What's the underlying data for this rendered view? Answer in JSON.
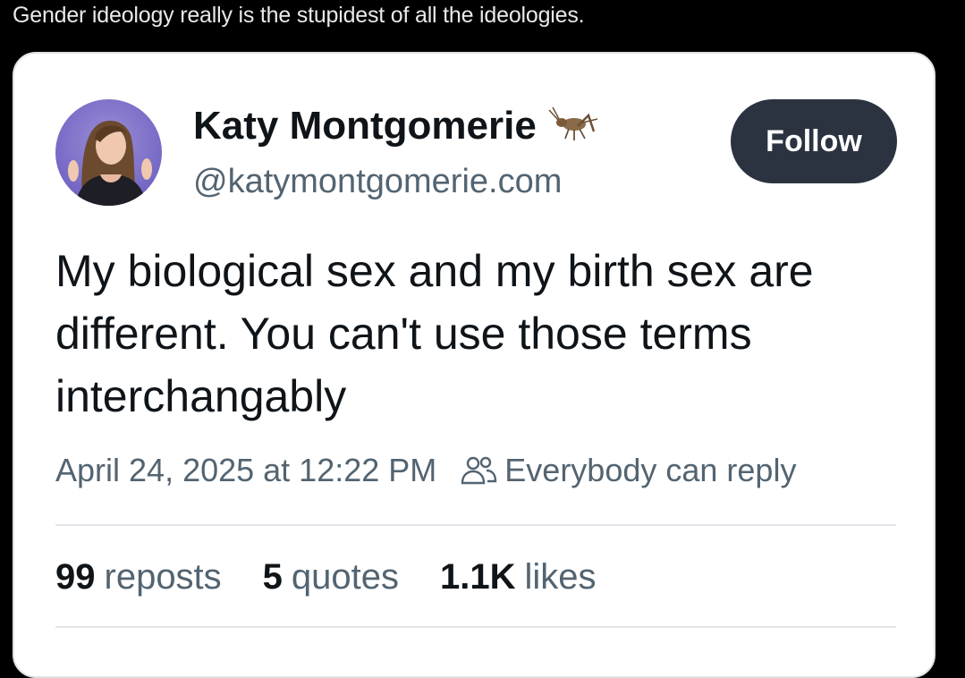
{
  "caption": "Gender ideology really is the stupidest of all the ideologies.",
  "tweet": {
    "author_name": "Katy Montgomerie",
    "author_handle": "@katymontgomerie.com",
    "follow_label": "Follow",
    "text": "My biological sex and my birth sex are different. You can't use those terms interchangably",
    "timestamp": "April 24, 2025 at 12:22 PM",
    "reply_setting": "Everybody can reply",
    "stats": {
      "reposts_count": "99",
      "reposts_label": "reposts",
      "quotes_count": "5",
      "quotes_label": "quotes",
      "likes_count": "1.1K",
      "likes_label": "likes"
    }
  },
  "icons": {
    "name_badge": "cricket-icon",
    "reply_setting": "people-icon"
  },
  "colors": {
    "background": "#000000",
    "card": "#ffffff",
    "follow_button": "#2b3340",
    "secondary_text": "#536471",
    "primary_text": "#0f1419"
  }
}
